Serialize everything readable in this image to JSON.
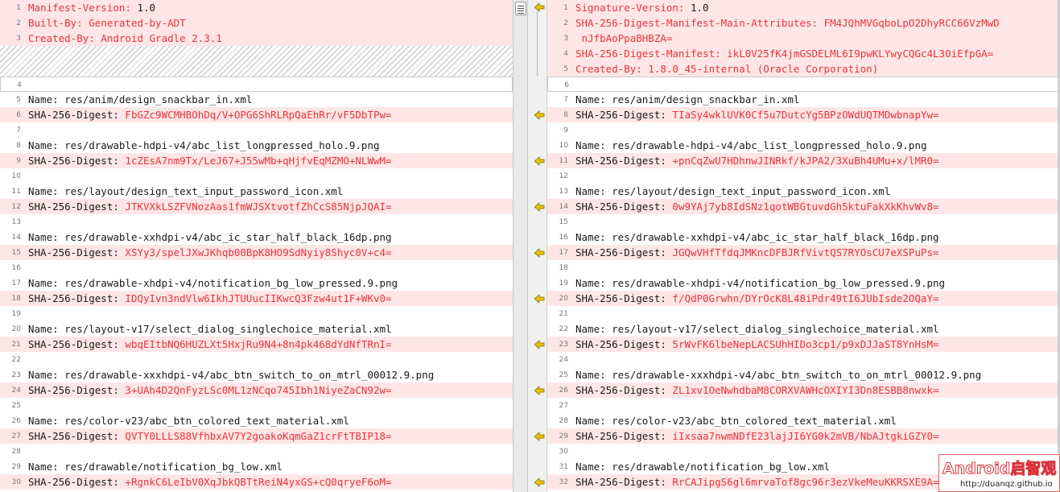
{
  "left_pane": {
    "lines": [
      {
        "n": "1",
        "hl": true,
        "key": "Manifest-Version: ",
        "val": "1.0",
        "key_color": "red",
        "val_color": "dark"
      },
      {
        "n": "2",
        "hl": true,
        "key": "Built-By: ",
        "val": "Generated-by-ADT",
        "key_color": "red",
        "val_color": "red"
      },
      {
        "n": "3",
        "hl": true,
        "key": "Created-By: ",
        "val": "Android Gradle 2.3.1",
        "key_color": "red",
        "val_color": "red"
      },
      {
        "filler": true
      },
      {
        "n": "4",
        "gap": true,
        "key": "",
        "val": ""
      },
      {
        "n": "5",
        "key": "Name: ",
        "val": "res/anim/design_snackbar_in.xml",
        "val_color": "dark"
      },
      {
        "n": "6",
        "hl": true,
        "key": "SHA-256-Digest: ",
        "val": "FbGZc9WCMHBOhDq/V+OPG6ShRLRpQaEhRr/vF5DbTPw="
      },
      {
        "n": "7",
        "blank": true,
        "key": "",
        "val": ""
      },
      {
        "n": "8",
        "key": "Name: ",
        "val": "res/drawable-hdpi-v4/abc_list_longpressed_holo.9.png",
        "val_color": "dark"
      },
      {
        "n": "9",
        "hl": true,
        "key": "SHA-256-Digest: ",
        "val": "1cZEsA7nm9Tx/LeJ67+J55wMb+qHjfvEqMZMO+NLWwM="
      },
      {
        "n": "10",
        "blank": true,
        "key": "",
        "val": ""
      },
      {
        "n": "11",
        "key": "Name: ",
        "val": "res/layout/design_text_input_password_icon.xml",
        "val_color": "dark"
      },
      {
        "n": "12",
        "hl": true,
        "key": "SHA-256-Digest: ",
        "val": "JTKVXkLSZFVNozAas1fmWJSXtvotfZhCcS85NjpJQAI="
      },
      {
        "n": "13",
        "blank": true,
        "key": "",
        "val": ""
      },
      {
        "n": "14",
        "key": "Name: ",
        "val": "res/drawable-xxhdpi-v4/abc_ic_star_half_black_16dp.png",
        "val_color": "dark"
      },
      {
        "n": "15",
        "hl": true,
        "key": "SHA-256-Digest: ",
        "val": "XSYy3/spelJXwJKhqb00BpK8HO9SdNyiy8Shyc0V+c4="
      },
      {
        "n": "16",
        "blank": true,
        "key": "",
        "val": ""
      },
      {
        "n": "17",
        "key": "Name: ",
        "val": "res/drawable-xhdpi-v4/notification_bg_low_pressed.9.png",
        "val_color": "dark"
      },
      {
        "n": "18",
        "hl": true,
        "key": "SHA-256-Digest: ",
        "val": "IDQyIvn3ndVlw6IkhJTUUucIIKwcQ3Fzw4ut1F+WKv0="
      },
      {
        "n": "19",
        "blank": true,
        "key": "",
        "val": ""
      },
      {
        "n": "20",
        "key": "Name: ",
        "val": "res/layout-v17/select_dialog_singlechoice_material.xml",
        "val_color": "dark"
      },
      {
        "n": "21",
        "hl": true,
        "key": "SHA-256-Digest: ",
        "val": "wbqEItbNQ6HUZLXt5HxjRu9N4+8n4pk468dYdNfTRnI="
      },
      {
        "n": "22",
        "blank": true,
        "key": "",
        "val": ""
      },
      {
        "n": "23",
        "key": "Name: ",
        "val": "res/drawable-xxxhdpi-v4/abc_btn_switch_to_on_mtrl_00012.9.png",
        "val_color": "dark"
      },
      {
        "n": "24",
        "hl": true,
        "key": "SHA-256-Digest: ",
        "val": "3+UAh4D2QnFyzLSc0ML1zNCqo745Ibh1NiyeZaCN92w="
      },
      {
        "n": "25",
        "blank": true,
        "key": "",
        "val": ""
      },
      {
        "n": "26",
        "key": "Name: ",
        "val": "res/color-v23/abc_btn_colored_text_material.xml",
        "val_color": "dark"
      },
      {
        "n": "27",
        "hl": true,
        "key": "SHA-256-Digest: ",
        "val": "QVTY0LLLS88VfhbxAV7Y2goakoKqmGaZ1crFtTBIP18="
      },
      {
        "n": "28",
        "blank": true,
        "key": "",
        "val": ""
      },
      {
        "n": "29",
        "key": "Name: ",
        "val": "res/drawable/notification_bg_low.xml",
        "val_color": "dark"
      },
      {
        "n": "30",
        "hl": true,
        "key": "SHA-256-Digest: ",
        "val": "+RgnkC6LeIbV0XqJbkQBTtReiN4yxGS+cQ0qryeF6oM="
      }
    ]
  },
  "right_pane": {
    "lines": [
      {
        "n": "1",
        "hl": true,
        "key": "Signature-Version: ",
        "val": "1.0",
        "key_color": "red",
        "val_color": "dark"
      },
      {
        "n": "2",
        "hl": true,
        "key": "SHA-256-Digest-Manifest-Main-Attributes: ",
        "val": "FM4JQhMVGqboLpO2DhyRCC66VzMwD",
        "key_color": "red",
        "val_color": "red"
      },
      {
        "n": "3",
        "hl": true,
        "key": "",
        "val": " nJfbAoPpaBHBZA=",
        "val_color": "red"
      },
      {
        "n": "4",
        "hl": true,
        "key": "SHA-256-Digest-Manifest: ",
        "val": "ikL0V25fK4jmGSDELML6I9pwKLYwyCQGc4L3OiEfpGA=",
        "key_color": "red",
        "val_color": "red"
      },
      {
        "n": "5",
        "hl": true,
        "key": "Created-By: ",
        "val": "1.8.0_45-internal (Oracle Corporation)",
        "key_color": "red",
        "val_color": "red"
      },
      {
        "n": "6",
        "gap": true,
        "key": "",
        "val": ""
      },
      {
        "n": "7",
        "key": "Name: ",
        "val": "res/anim/design_snackbar_in.xml",
        "val_color": "dark"
      },
      {
        "n": "8",
        "hl": true,
        "key": "SHA-256-Digest: ",
        "val": "TIaSy4wklUVK0Cf5u7DutcYg5BPzOWdUQTMDwbnapYw="
      },
      {
        "n": "9",
        "blank": true,
        "key": "",
        "val": ""
      },
      {
        "n": "10",
        "key": "Name: ",
        "val": "res/drawable-hdpi-v4/abc_list_longpressed_holo.9.png",
        "val_color": "dark"
      },
      {
        "n": "11",
        "hl": true,
        "key": "SHA-256-Digest: ",
        "val": "+pnCqZwU7HDhnwJINRkf/kJPA2/3XuBh4UMu+x/lMR0="
      },
      {
        "n": "12",
        "blank": true,
        "key": "",
        "val": ""
      },
      {
        "n": "13",
        "key": "Name: ",
        "val": "res/layout/design_text_input_password_icon.xml",
        "val_color": "dark"
      },
      {
        "n": "14",
        "hl": true,
        "key": "SHA-256-Digest: ",
        "val": "0w9YAj7yb8IdSNz1qotWBGtuvdGh5ktuFakXkKhvWv8="
      },
      {
        "n": "15",
        "blank": true,
        "key": "",
        "val": ""
      },
      {
        "n": "16",
        "key": "Name: ",
        "val": "res/drawable-xxhdpi-v4/abc_ic_star_half_black_16dp.png",
        "val_color": "dark"
      },
      {
        "n": "17",
        "hl": true,
        "key": "SHA-256-Digest: ",
        "val": "JGQwVHfTfdqJMKncDFBJRfVivtQS7RYOsCU7eXSPuPs="
      },
      {
        "n": "18",
        "blank": true,
        "key": "",
        "val": ""
      },
      {
        "n": "19",
        "key": "Name: ",
        "val": "res/drawable-xhdpi-v4/notification_bg_low_pressed.9.png",
        "val_color": "dark"
      },
      {
        "n": "20",
        "hl": true,
        "key": "SHA-256-Digest: ",
        "val": "f/QdP0Grwhn/DYrOcK8L48iPdr49tI6JUbIsde2OQaY="
      },
      {
        "n": "21",
        "blank": true,
        "key": "",
        "val": ""
      },
      {
        "n": "22",
        "key": "Name: ",
        "val": "res/layout-v17/select_dialog_singlechoice_material.xml",
        "val_color": "dark"
      },
      {
        "n": "23",
        "hl": true,
        "key": "SHA-256-Digest: ",
        "val": "5rWvFK6lbeNepLACSUhHIDo3cp1/p9xDJJaST8YnHsM="
      },
      {
        "n": "24",
        "blank": true,
        "key": "",
        "val": ""
      },
      {
        "n": "25",
        "key": "Name: ",
        "val": "res/drawable-xxxhdpi-v4/abc_btn_switch_to_on_mtrl_00012.9.png",
        "val_color": "dark"
      },
      {
        "n": "26",
        "hl": true,
        "key": "SHA-256-Digest: ",
        "val": "ZL1xv1OeNwhdbaM8CORXVAWHcOXIYI3Dn8ESBB8nwxk="
      },
      {
        "n": "27",
        "blank": true,
        "key": "",
        "val": ""
      },
      {
        "n": "28",
        "key": "Name: ",
        "val": "res/color-v23/abc_btn_colored_text_material.xml",
        "val_color": "dark"
      },
      {
        "n": "29",
        "hl": true,
        "key": "SHA-256-Digest: ",
        "val": "iIxsaa7nwmNDfE23lajJI6YG0k2mVB/NbAJtgkiGZY0="
      },
      {
        "n": "30",
        "blank": true,
        "key": "",
        "val": ""
      },
      {
        "n": "31",
        "key": "Name: ",
        "val": "res/drawable/notification_bg_low.xml",
        "val_color": "dark"
      },
      {
        "n": "32",
        "hl": true,
        "key": "SHA-256-Digest: ",
        "val": "RrCAJipgS6gl6mrvaTof8gc96r3ezVkeMeuKKRSXE9A="
      }
    ]
  },
  "gutter": {
    "icon": "left-arrow-icon",
    "arrow_color": "#e6c200"
  },
  "watermark": {
    "logo_text": "Android启智观",
    "url": "http://duanqz.github.io"
  },
  "colors": {
    "diff_red": "#e8333b",
    "highlight_bg": "#ffe6e6",
    "arrow_yellow": "#e6c200"
  }
}
